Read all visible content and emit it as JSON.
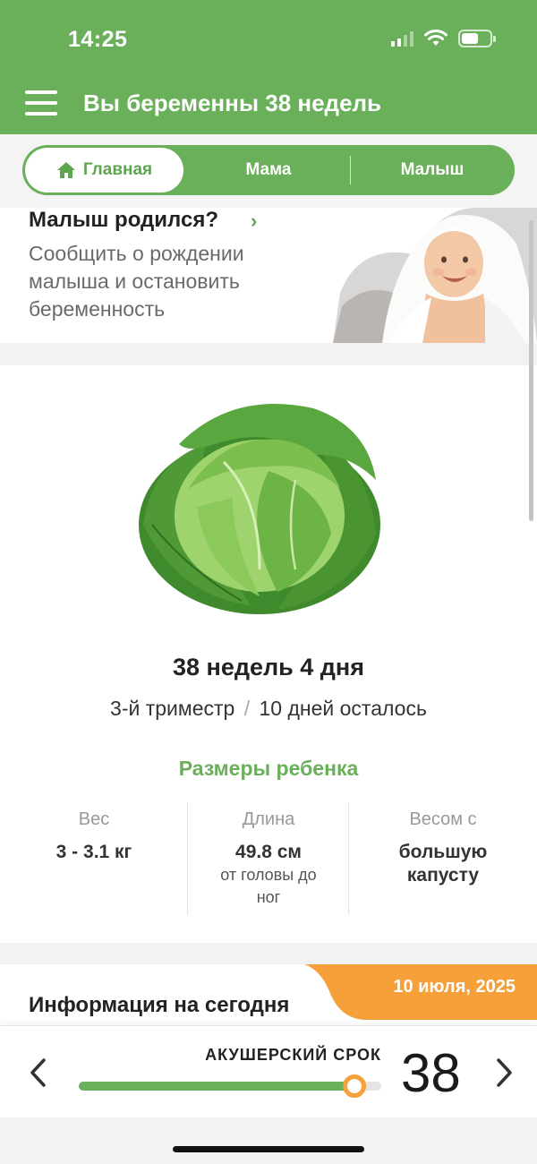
{
  "status_bar": {
    "time": "14:25"
  },
  "header": {
    "title": "Вы беременны 38 недель"
  },
  "tabs": [
    {
      "label": "Главная",
      "active": true
    },
    {
      "label": "Мама",
      "active": false
    },
    {
      "label": "Малыш",
      "active": false
    }
  ],
  "born_card": {
    "title": "Малыш родился?",
    "description": "Сообщить о рождении малыша и остановить беременность"
  },
  "pregnancy": {
    "week_title": "38 недель 4 дня",
    "trimester": "3-й триместр",
    "separator": "/",
    "remaining": "10 дней осталось"
  },
  "sizes": {
    "title": "Размеры ребенка",
    "weight": {
      "label": "Вес",
      "value": "3 - 3.1 кг"
    },
    "length": {
      "label": "Длина",
      "value": "49.8 см",
      "note": "от головы до ног"
    },
    "similar": {
      "label": "Весом с",
      "value": "большую капусту"
    }
  },
  "today_info": {
    "title": "Информация на сегодня",
    "date": "10 июля, 2025"
  },
  "term": {
    "label": "АКУШЕРСКИЙ СРОК",
    "week": "38",
    "progress": 0.91
  },
  "colors": {
    "brand_green": "#6aaf5a",
    "accent_orange": "#f5a038"
  }
}
